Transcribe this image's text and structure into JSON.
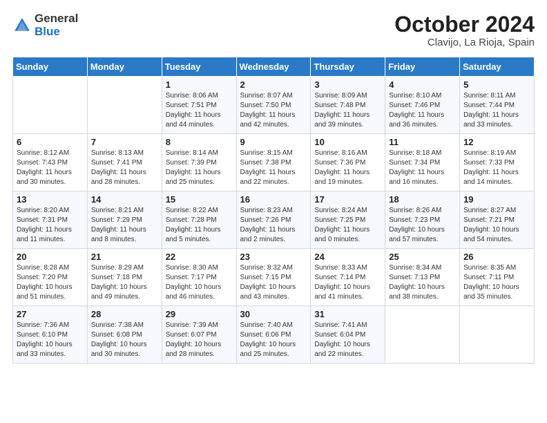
{
  "header": {
    "logo_general": "General",
    "logo_blue": "Blue",
    "month_title": "October 2024",
    "subtitle": "Clavijo, La Rioja, Spain"
  },
  "days_of_week": [
    "Sunday",
    "Monday",
    "Tuesday",
    "Wednesday",
    "Thursday",
    "Friday",
    "Saturday"
  ],
  "weeks": [
    [
      {
        "day": "",
        "info": ""
      },
      {
        "day": "",
        "info": ""
      },
      {
        "day": "1",
        "info": "Sunrise: 8:06 AM\nSunset: 7:51 PM\nDaylight: 11 hours and 44 minutes."
      },
      {
        "day": "2",
        "info": "Sunrise: 8:07 AM\nSunset: 7:50 PM\nDaylight: 11 hours and 42 minutes."
      },
      {
        "day": "3",
        "info": "Sunrise: 8:09 AM\nSunset: 7:48 PM\nDaylight: 11 hours and 39 minutes."
      },
      {
        "day": "4",
        "info": "Sunrise: 8:10 AM\nSunset: 7:46 PM\nDaylight: 11 hours and 36 minutes."
      },
      {
        "day": "5",
        "info": "Sunrise: 8:11 AM\nSunset: 7:44 PM\nDaylight: 11 hours and 33 minutes."
      }
    ],
    [
      {
        "day": "6",
        "info": "Sunrise: 8:12 AM\nSunset: 7:43 PM\nDaylight: 11 hours and 30 minutes."
      },
      {
        "day": "7",
        "info": "Sunrise: 8:13 AM\nSunset: 7:41 PM\nDaylight: 11 hours and 28 minutes."
      },
      {
        "day": "8",
        "info": "Sunrise: 8:14 AM\nSunset: 7:39 PM\nDaylight: 11 hours and 25 minutes."
      },
      {
        "day": "9",
        "info": "Sunrise: 8:15 AM\nSunset: 7:38 PM\nDaylight: 11 hours and 22 minutes."
      },
      {
        "day": "10",
        "info": "Sunrise: 8:16 AM\nSunset: 7:36 PM\nDaylight: 11 hours and 19 minutes."
      },
      {
        "day": "11",
        "info": "Sunrise: 8:18 AM\nSunset: 7:34 PM\nDaylight: 11 hours and 16 minutes."
      },
      {
        "day": "12",
        "info": "Sunrise: 8:19 AM\nSunset: 7:33 PM\nDaylight: 11 hours and 14 minutes."
      }
    ],
    [
      {
        "day": "13",
        "info": "Sunrise: 8:20 AM\nSunset: 7:31 PM\nDaylight: 11 hours and 11 minutes."
      },
      {
        "day": "14",
        "info": "Sunrise: 8:21 AM\nSunset: 7:29 PM\nDaylight: 11 hours and 8 minutes."
      },
      {
        "day": "15",
        "info": "Sunrise: 8:22 AM\nSunset: 7:28 PM\nDaylight: 11 hours and 5 minutes."
      },
      {
        "day": "16",
        "info": "Sunrise: 8:23 AM\nSunset: 7:26 PM\nDaylight: 11 hours and 2 minutes."
      },
      {
        "day": "17",
        "info": "Sunrise: 8:24 AM\nSunset: 7:25 PM\nDaylight: 11 hours and 0 minutes."
      },
      {
        "day": "18",
        "info": "Sunrise: 8:26 AM\nSunset: 7:23 PM\nDaylight: 10 hours and 57 minutes."
      },
      {
        "day": "19",
        "info": "Sunrise: 8:27 AM\nSunset: 7:21 PM\nDaylight: 10 hours and 54 minutes."
      }
    ],
    [
      {
        "day": "20",
        "info": "Sunrise: 8:28 AM\nSunset: 7:20 PM\nDaylight: 10 hours and 51 minutes."
      },
      {
        "day": "21",
        "info": "Sunrise: 8:29 AM\nSunset: 7:18 PM\nDaylight: 10 hours and 49 minutes."
      },
      {
        "day": "22",
        "info": "Sunrise: 8:30 AM\nSunset: 7:17 PM\nDaylight: 10 hours and 46 minutes."
      },
      {
        "day": "23",
        "info": "Sunrise: 8:32 AM\nSunset: 7:15 PM\nDaylight: 10 hours and 43 minutes."
      },
      {
        "day": "24",
        "info": "Sunrise: 8:33 AM\nSunset: 7:14 PM\nDaylight: 10 hours and 41 minutes."
      },
      {
        "day": "25",
        "info": "Sunrise: 8:34 AM\nSunset: 7:13 PM\nDaylight: 10 hours and 38 minutes."
      },
      {
        "day": "26",
        "info": "Sunrise: 8:35 AM\nSunset: 7:11 PM\nDaylight: 10 hours and 35 minutes."
      }
    ],
    [
      {
        "day": "27",
        "info": "Sunrise: 7:36 AM\nSunset: 6:10 PM\nDaylight: 10 hours and 33 minutes."
      },
      {
        "day": "28",
        "info": "Sunrise: 7:38 AM\nSunset: 6:08 PM\nDaylight: 10 hours and 30 minutes."
      },
      {
        "day": "29",
        "info": "Sunrise: 7:39 AM\nSunset: 6:07 PM\nDaylight: 10 hours and 28 minutes."
      },
      {
        "day": "30",
        "info": "Sunrise: 7:40 AM\nSunset: 6:06 PM\nDaylight: 10 hours and 25 minutes."
      },
      {
        "day": "31",
        "info": "Sunrise: 7:41 AM\nSunset: 6:04 PM\nDaylight: 10 hours and 22 minutes."
      },
      {
        "day": "",
        "info": ""
      },
      {
        "day": "",
        "info": ""
      }
    ]
  ]
}
